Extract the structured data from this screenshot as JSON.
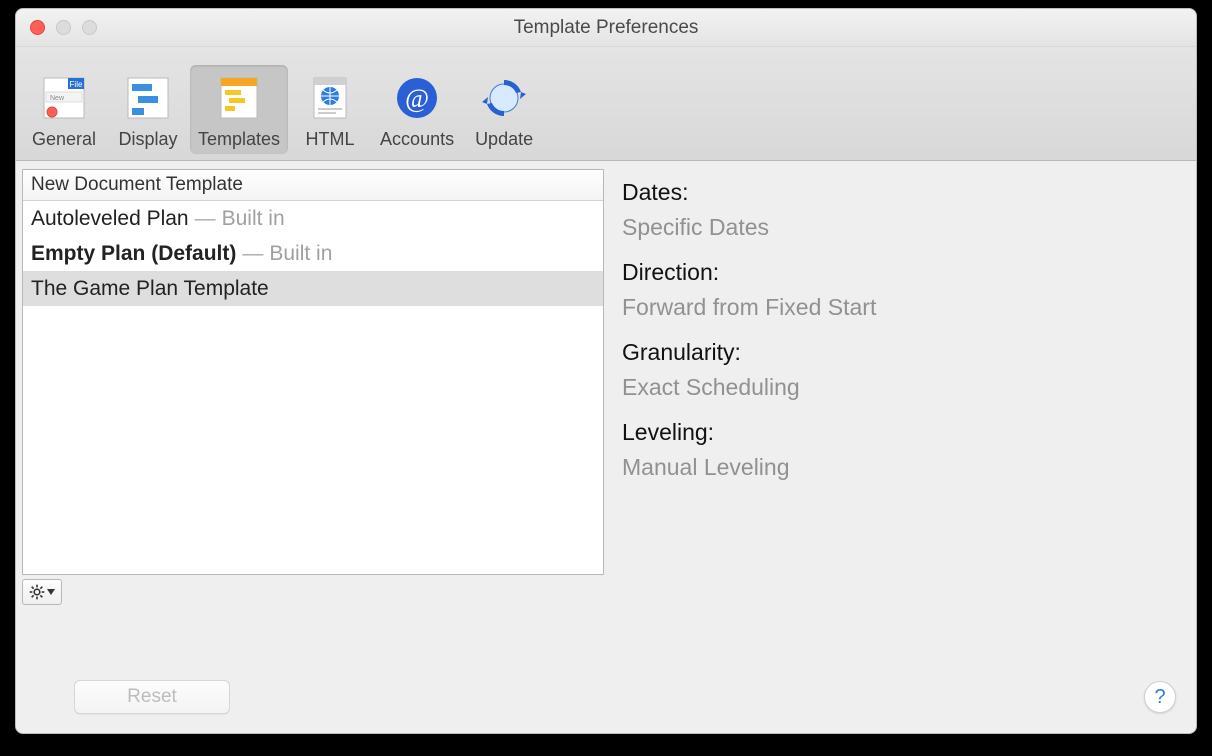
{
  "window_title": "Template Preferences",
  "toolbar": {
    "items": [
      {
        "label": "General"
      },
      {
        "label": "Display"
      },
      {
        "label": "Templates"
      },
      {
        "label": "HTML"
      },
      {
        "label": "Accounts"
      },
      {
        "label": "Update"
      }
    ],
    "selected_index": 2
  },
  "list": {
    "header": "New Document Template",
    "rows": [
      {
        "name": "Autoleveled Plan",
        "suffix": "Built in",
        "bold": false,
        "selected": false
      },
      {
        "name": "Empty Plan (Default)",
        "suffix": "Built in",
        "bold": true,
        "selected": false
      },
      {
        "name": "The Game Plan Template",
        "suffix": "",
        "bold": false,
        "selected": true
      }
    ]
  },
  "details": {
    "dates_label": "Dates:",
    "dates_value": "Specific Dates",
    "direction_label": "Direction:",
    "direction_value": "Forward from Fixed Start",
    "granularity_label": "Granularity:",
    "granularity_value": "Exact Scheduling",
    "leveling_label": "Leveling:",
    "leveling_value": "Manual Leveling"
  },
  "footer": {
    "reset_label": "Reset",
    "help_label": "?"
  }
}
